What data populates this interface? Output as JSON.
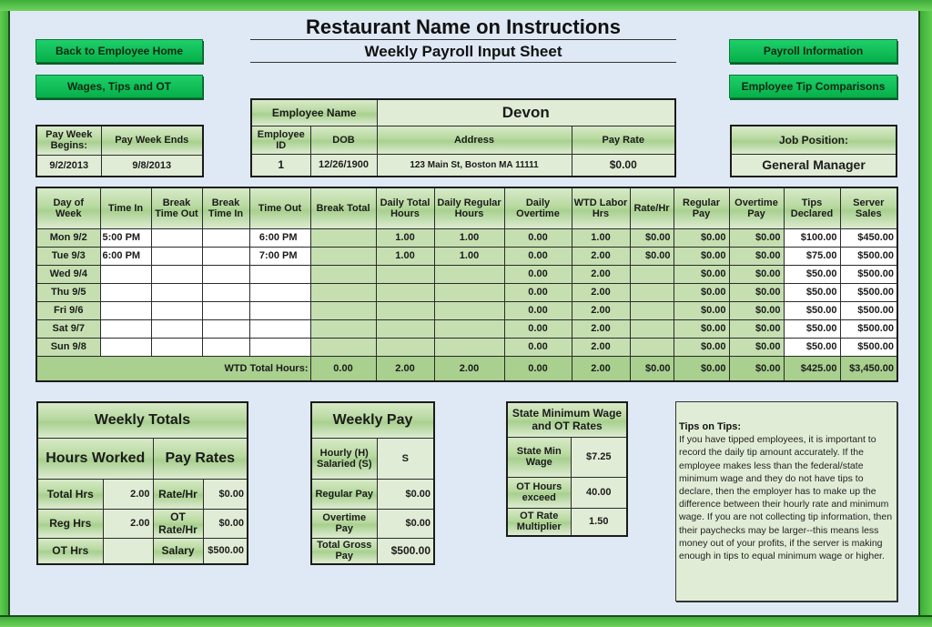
{
  "header": {
    "title": "Restaurant Name on Instructions",
    "subtitle": "Weekly Payroll Input Sheet"
  },
  "nav": {
    "back_home": "Back to Employee Home",
    "wages_tips_ot": "Wages, Tips and OT",
    "payroll_info": "Payroll Information",
    "tip_comparisons": "Employee Tip Comparisons"
  },
  "pay_week": {
    "begins_label": "Pay Week Begins:",
    "ends_label": "Pay Week Ends",
    "begins": "9/2/2013",
    "ends": "9/8/2013"
  },
  "employee": {
    "name_label": "Employee Name",
    "name": "Devon",
    "id_label": "Employee ID",
    "dob_label": "DOB",
    "address_label": "Address",
    "pay_rate_label": "Pay Rate",
    "id": "1",
    "dob": "12/26/1900",
    "address": "123 Main St, Boston MA 11111",
    "pay_rate": "$0.00"
  },
  "job": {
    "label": "Job Position:",
    "value": "General Manager"
  },
  "timesheet": {
    "columns": [
      "Day of Week",
      "Time In",
      "Break Time Out",
      "Break Time In",
      "Time Out",
      "Break Total",
      "Daily Total Hours",
      "Daily Regular Hours",
      "Daily Overtime",
      "WTD Labor Hrs",
      "Rate/Hr",
      "Regular Pay",
      "Overtime Pay",
      "Tips Declared",
      "Server Sales"
    ],
    "rows": [
      {
        "day": "Mon 9/2",
        "time_in": "5:00 PM",
        "break_out": "",
        "break_in": "",
        "time_out": "6:00 PM",
        "break_total": "",
        "daily_total": "1.00",
        "daily_regular": "1.00",
        "daily_ot": "0.00",
        "wtd_labor": "1.00",
        "rate": "$0.00",
        "regular_pay": "$0.00",
        "ot_pay": "$0.00",
        "tips": "$100.00",
        "sales": "$450.00"
      },
      {
        "day": "Tue 9/3",
        "time_in": "6:00 PM",
        "break_out": "",
        "break_in": "",
        "time_out": "7:00 PM",
        "break_total": "",
        "daily_total": "1.00",
        "daily_regular": "1.00",
        "daily_ot": "0.00",
        "wtd_labor": "2.00",
        "rate": "$0.00",
        "regular_pay": "$0.00",
        "ot_pay": "$0.00",
        "tips": "$75.00",
        "sales": "$500.00"
      },
      {
        "day": "Wed 9/4",
        "time_in": "",
        "break_out": "",
        "break_in": "",
        "time_out": "",
        "break_total": "",
        "daily_total": "",
        "daily_regular": "",
        "daily_ot": "0.00",
        "wtd_labor": "2.00",
        "rate": "",
        "regular_pay": "$0.00",
        "ot_pay": "$0.00",
        "tips": "$50.00",
        "sales": "$500.00"
      },
      {
        "day": "Thu 9/5",
        "time_in": "",
        "break_out": "",
        "break_in": "",
        "time_out": "",
        "break_total": "",
        "daily_total": "",
        "daily_regular": "",
        "daily_ot": "0.00",
        "wtd_labor": "2.00",
        "rate": "",
        "regular_pay": "$0.00",
        "ot_pay": "$0.00",
        "tips": "$50.00",
        "sales": "$500.00"
      },
      {
        "day": "Fri 9/6",
        "time_in": "",
        "break_out": "",
        "break_in": "",
        "time_out": "",
        "break_total": "",
        "daily_total": "",
        "daily_regular": "",
        "daily_ot": "0.00",
        "wtd_labor": "2.00",
        "rate": "",
        "regular_pay": "$0.00",
        "ot_pay": "$0.00",
        "tips": "$50.00",
        "sales": "$500.00"
      },
      {
        "day": "Sat 9/7",
        "time_in": "",
        "break_out": "",
        "break_in": "",
        "time_out": "",
        "break_total": "",
        "daily_total": "",
        "daily_regular": "",
        "daily_ot": "0.00",
        "wtd_labor": "2.00",
        "rate": "",
        "regular_pay": "$0.00",
        "ot_pay": "$0.00",
        "tips": "$50.00",
        "sales": "$500.00"
      },
      {
        "day": "Sun 9/8",
        "time_in": "",
        "break_out": "",
        "break_in": "",
        "time_out": "",
        "break_total": "",
        "daily_total": "",
        "daily_regular": "",
        "daily_ot": "0.00",
        "wtd_labor": "2.00",
        "rate": "",
        "regular_pay": "$0.00",
        "ot_pay": "$0.00",
        "tips": "$50.00",
        "sales": "$500.00"
      }
    ],
    "totals": {
      "label": "WTD Total Hours:",
      "break_total": "0.00",
      "daily_total": "2.00",
      "daily_regular": "2.00",
      "daily_ot": "0.00",
      "wtd_labor": "2.00",
      "rate": "$0.00",
      "regular_pay": "$0.00",
      "ot_pay": "$0.00",
      "tips": "$425.00",
      "sales": "$3,450.00"
    }
  },
  "weekly_totals": {
    "title": "Weekly Totals",
    "hours_worked_label": "Hours Worked",
    "pay_rates_label": "Pay Rates",
    "total_hrs_label": "Total Hrs",
    "total_hrs": "2.00",
    "reg_hrs_label": "Reg Hrs",
    "reg_hrs": "2.00",
    "ot_hrs_label": "OT Hrs",
    "ot_hrs": "",
    "rate_hr_label": "Rate/Hr",
    "rate_hr": "$0.00",
    "ot_rate_label": "OT Rate/Hr",
    "ot_rate": "$0.00",
    "salary_label": "Salary",
    "salary": "$500.00"
  },
  "weekly_pay": {
    "title": "Weekly Pay",
    "type_label": "Hourly (H) Salaried (S)",
    "type": "S",
    "regular_pay_label": "Regular Pay",
    "regular_pay": "$0.00",
    "overtime_pay_label": "Overtime Pay",
    "overtime_pay": "$0.00",
    "gross_label": "Total Gross Pay",
    "gross": "$500.00"
  },
  "state_rates": {
    "title": "State Minimum Wage and OT Rates",
    "min_wage_label": "State Min Wage",
    "min_wage": "$7.25",
    "ot_hours_label": "OT Hours exceed",
    "ot_hours": "40.00",
    "ot_mult_label": "OT Rate Multiplier",
    "ot_mult": "1.50"
  },
  "tips": {
    "title": "Tips on Tips:",
    "body": "If you have tipped employees, it is important to record the daily tip amount accurately. If the employee makes less than the federal/state minimum wage and they do not have tips to declare, then the employer has to make up the difference between their hourly rate and minimum wage. If you are not collecting tip information, then their paychecks may be larger--this means less money out of your profits, if the server is making enough in tips to equal minimum wage or higher."
  }
}
